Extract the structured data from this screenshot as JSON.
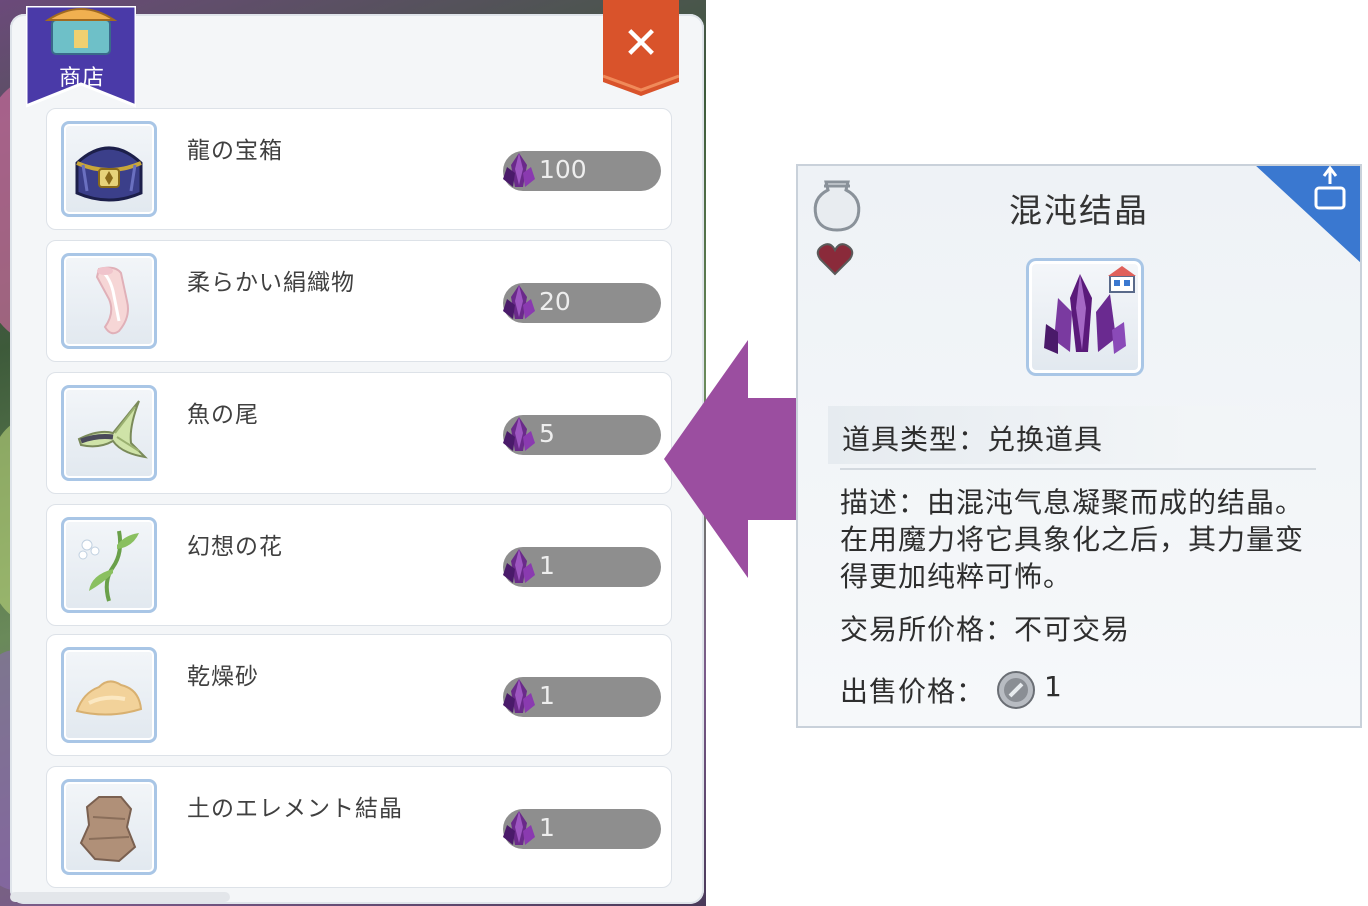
{
  "shop": {
    "title": "商店",
    "close_label": "✕",
    "items": [
      {
        "name": "龍の宝箱",
        "price": "100",
        "icon": "treasure-chest-icon"
      },
      {
        "name": "柔らかい絹織物",
        "price": "20",
        "icon": "silk-cloth-icon"
      },
      {
        "name": "魚の尾",
        "price": "5",
        "icon": "fish-tail-icon"
      },
      {
        "name": "幻想の花",
        "price": "1",
        "icon": "fantasy-flower-icon"
      },
      {
        "name": "乾燥砂",
        "price": "1",
        "icon": "dry-sand-icon"
      },
      {
        "name": "土のエレメント結晶",
        "price": "1",
        "icon": "earth-element-crystal-icon"
      }
    ],
    "currency_icon": "purple-crystal-gem-icon"
  },
  "detail": {
    "title": "混沌结晶",
    "type_line": "道具类型：兑换道具",
    "description": "描述：由混沌气息凝聚而成的结晶。在用魔力将它具象化之后，其力量变得更加纯粹可怖。",
    "trade_line": "交易所价格：不可交易",
    "sell_label": "出售价格：",
    "sell_value": "1",
    "icons": [
      "jar-icon",
      "heart-icon",
      "share-badge-icon",
      "chaos-crystal-icon",
      "shop-tag-icon",
      "silver-coin-icon"
    ]
  },
  "colors": {
    "ribbon": "#4a3aa8",
    "close": "#d9532b",
    "arrow": "#9b4ea0",
    "price_pill": "#8e8e8e",
    "thumb_border": "#a9c6e6",
    "corner_badge": "#3a78d0"
  }
}
